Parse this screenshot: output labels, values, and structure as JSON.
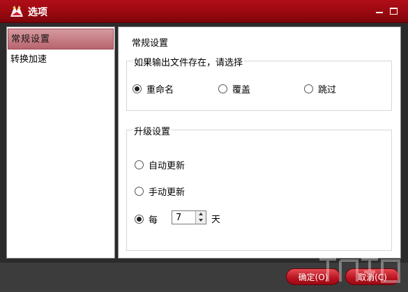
{
  "window": {
    "title": "选项"
  },
  "sidebar": {
    "items": [
      {
        "label": "常规设置",
        "active": true
      },
      {
        "label": "转换加速",
        "active": false
      }
    ]
  },
  "panel": {
    "title": "常规设置",
    "output_group": {
      "legend": "如果输出文件存在，请选择",
      "options": [
        {
          "label": "重命名",
          "checked": true
        },
        {
          "label": "覆盖",
          "checked": false
        },
        {
          "label": "跳过",
          "checked": false
        }
      ]
    },
    "update_group": {
      "legend": "升级设置",
      "options": [
        {
          "label": "自动更新",
          "checked": false
        },
        {
          "label": "手动更新",
          "checked": false
        },
        {
          "label": "每",
          "checked": true
        }
      ],
      "interval_value": "7",
      "interval_unit": "天"
    }
  },
  "footer": {
    "ok_label": "确定(O)",
    "cancel_label": "取消(C)"
  },
  "colors": {
    "accent": "#a60b14",
    "selected_item": "#c07880"
  }
}
